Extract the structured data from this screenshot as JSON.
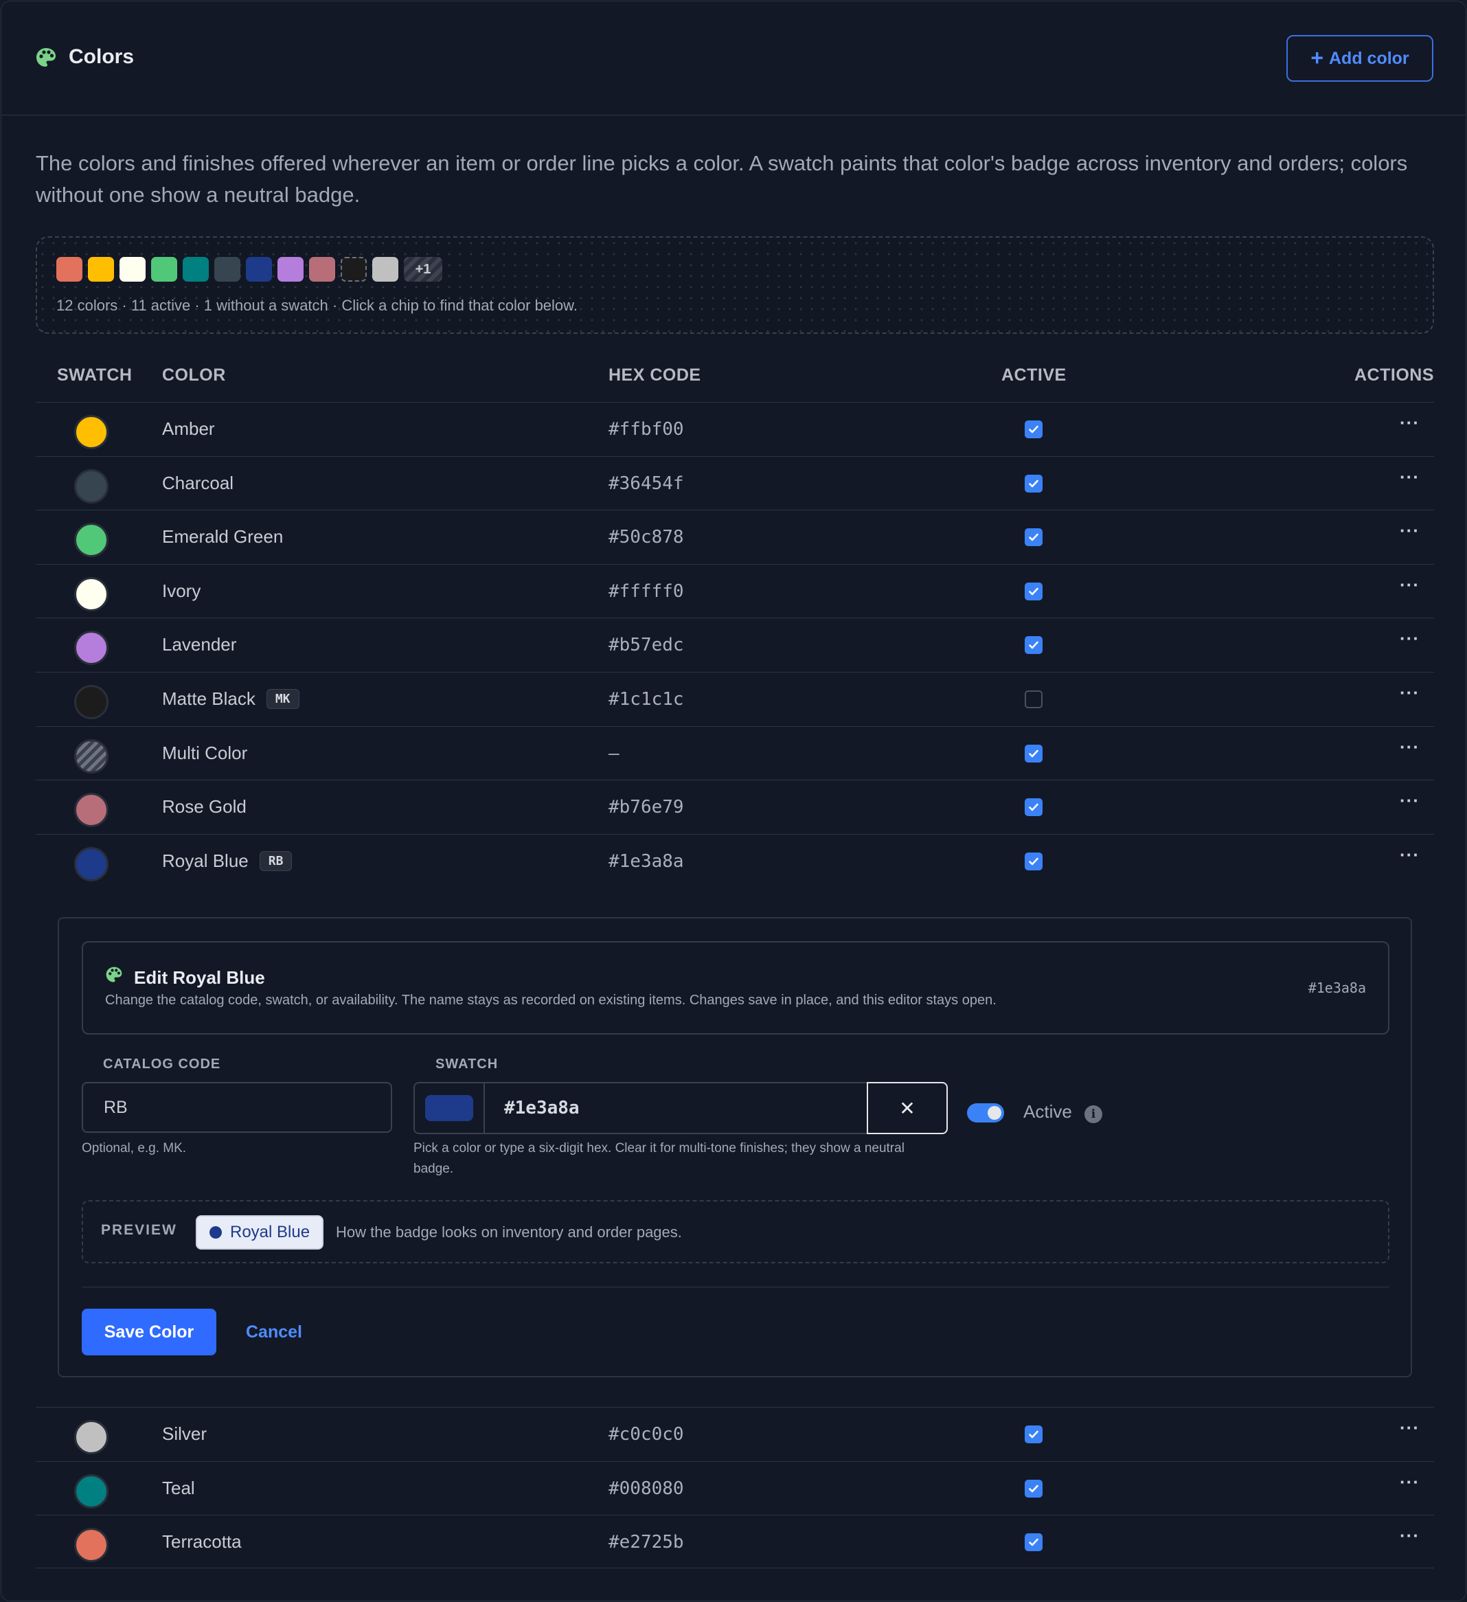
{
  "header": {
    "title": "Colors",
    "add_label": "Add color",
    "add_icon": "plus-icon",
    "palette_icon": "palette-icon"
  },
  "description": "The colors and finishes offered wherever an item or order line picks a color. A swatch paints that color's badge across inventory and orders; colors without one show a neutral badge.",
  "summary": {
    "chips": [
      "#e2725b",
      "#ffbf00",
      "#fffff0",
      "#50c878",
      "#008080",
      "#36454f",
      "#1e3a8a",
      "#b57edc",
      "#b76e79",
      "#1c1c1c",
      "#c0c0c0"
    ],
    "more_label": "+1",
    "text": "12 colors · 11 active · 1 without a swatch · Click a chip to find that color below."
  },
  "table": {
    "headers": {
      "swatch": "SWATCH",
      "color": "COLOR",
      "hex": "HEX CODE",
      "active": "ACTIVE",
      "actions": "ACTIONS"
    },
    "rows_top": [
      {
        "name": "Amber",
        "code": "",
        "hex": "#ffbf00",
        "swatch": "#ffbf00",
        "active": true
      },
      {
        "name": "Charcoal",
        "code": "",
        "hex": "#36454f",
        "swatch": "#36454f",
        "active": true
      },
      {
        "name": "Emerald Green",
        "code": "",
        "hex": "#50c878",
        "swatch": "#50c878",
        "active": true
      },
      {
        "name": "Ivory",
        "code": "",
        "hex": "#fffff0",
        "swatch": "#fffff0",
        "active": true
      },
      {
        "name": "Lavender",
        "code": "",
        "hex": "#b57edc",
        "swatch": "#b57edc",
        "active": true
      },
      {
        "name": "Matte Black",
        "code": "MK",
        "hex": "#1c1c1c",
        "swatch": "#1c1c1c",
        "active": false
      },
      {
        "name": "Multi Color",
        "code": "",
        "hex": "—",
        "swatch": "",
        "active": true
      },
      {
        "name": "Rose Gold",
        "code": "",
        "hex": "#b76e79",
        "swatch": "#b76e79",
        "active": true
      },
      {
        "name": "Royal Blue",
        "code": "RB",
        "hex": "#1e3a8a",
        "swatch": "#1e3a8a",
        "active": true
      }
    ],
    "rows_bottom": [
      {
        "name": "Silver",
        "code": "",
        "hex": "#c0c0c0",
        "swatch": "#c0c0c0",
        "active": true
      },
      {
        "name": "Teal",
        "code": "",
        "hex": "#008080",
        "swatch": "#008080",
        "active": true
      },
      {
        "name": "Terracotta",
        "code": "",
        "hex": "#e2725b",
        "swatch": "#e2725b",
        "active": true
      }
    ],
    "actions_label": "···"
  },
  "editor": {
    "title": "Edit Royal Blue",
    "subtitle": "Change the catalog code, swatch, or availability. The name stays as recorded on existing items. Changes save in place, and this editor stays open.",
    "hex_display": "#1e3a8a",
    "catalog_code": {
      "label": "CATALOG CODE",
      "value": "RB",
      "help": "Optional, e.g. MK."
    },
    "swatch": {
      "label": "SWATCH",
      "value": "#1e3a8a",
      "clear_label": "✕",
      "help": "Pick a color or type a six-digit hex. Clear it for multi-tone finishes; they show a neutral badge."
    },
    "active": {
      "label": "Active",
      "on": true,
      "info_glyph": "i"
    },
    "preview": {
      "label": "PREVIEW",
      "badge": "Royal Blue",
      "text": "How the badge looks on inventory and order pages."
    },
    "save_label": "Save Color",
    "cancel_label": "Cancel"
  },
  "colors": {
    "accent": "#3b82f6",
    "primary_button": "#2f6bff",
    "link": "#4f8cff",
    "palette_icon": "#7bd389"
  }
}
